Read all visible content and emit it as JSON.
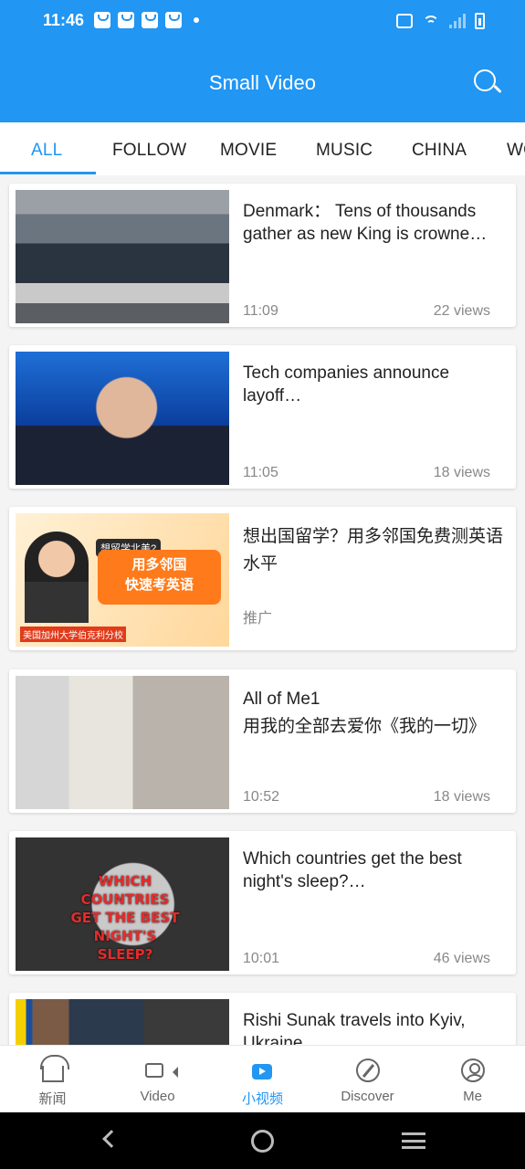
{
  "status": {
    "time": "11:46"
  },
  "header": {
    "title": "Small Video"
  },
  "tabs": [
    "ALL",
    "FOLLOW",
    "MOVIE",
    "MUSIC",
    "CHINA",
    "WO"
  ],
  "feed": [
    {
      "title": "Denmark： Tens of thousands gather as new King is crowne…",
      "time": "11:09",
      "views": "22 views"
    },
    {
      "title": "Tech companies announce layoff…",
      "time": "11:05",
      "views": "18 views"
    },
    {
      "title": "想出国留学？用多邻国免费测英语水平",
      "ad_label": "推广",
      "ad_tag": "想留学北美?",
      "ad_line1": "用多邻国",
      "ad_line2": "快速考英语",
      "ad_bottom": "美国加州大学伯克利分校"
    },
    {
      "title": "All of Me1\n用我的全部去爱你《我的一切》",
      "time": "10:52",
      "views": "18 views"
    },
    {
      "title": "Which countries get the best night's sleep?…",
      "time": "10:01",
      "views": "46 views",
      "thumb_text": "WHICH COUNTRIES GET THE BEST NIGHT'S SLEEP?"
    },
    {
      "title": "Rishi Sunak travels into Kyiv, Ukraine"
    }
  ],
  "nav": [
    {
      "label": "新闻",
      "icon": "news-home-icon"
    },
    {
      "label": "Video",
      "icon": "video-camera-icon"
    },
    {
      "label": "小视频",
      "icon": "small-video-icon"
    },
    {
      "label": "Discover",
      "icon": "compass-icon"
    },
    {
      "label": "Me",
      "icon": "user-icon"
    }
  ]
}
